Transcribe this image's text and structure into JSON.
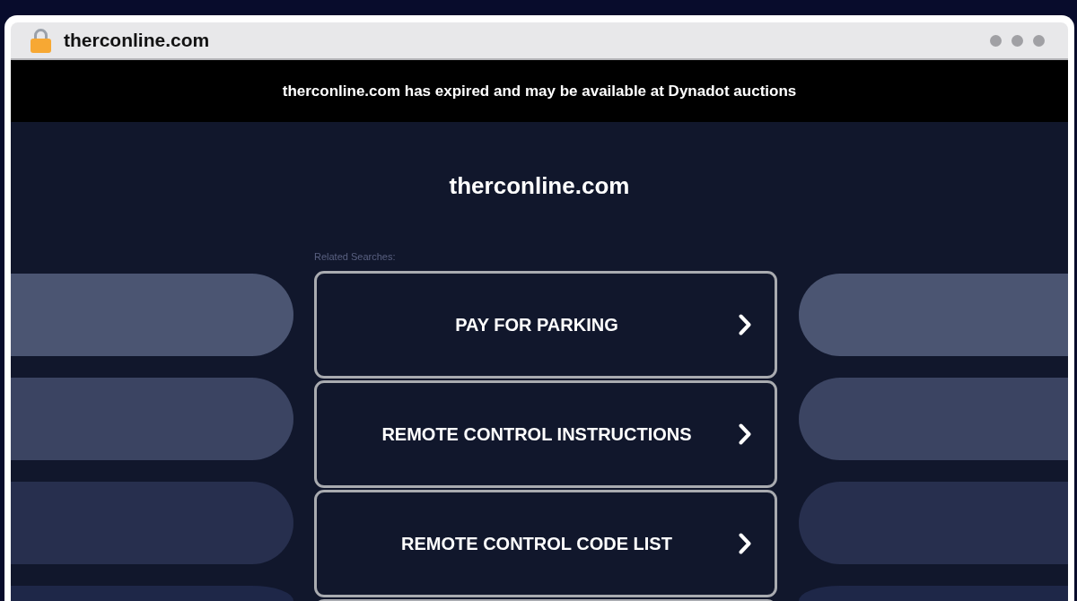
{
  "browser": {
    "url": "therconline.com"
  },
  "banner": {
    "text": "therconline.com has expired and may be available at Dynadot auctions"
  },
  "page": {
    "title": "therconline.com",
    "related_searches_label": "Related Searches:",
    "related_searches": [
      {
        "label": "PAY FOR PARKING"
      },
      {
        "label": "REMOTE CONTROL INSTRUCTIONS"
      },
      {
        "label": "REMOTE CONTROL CODE LIST"
      }
    ]
  }
}
